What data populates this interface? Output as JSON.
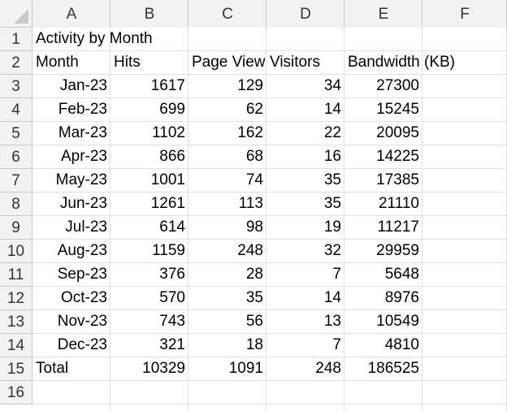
{
  "column_headers": [
    "A",
    "B",
    "C",
    "D",
    "E",
    "F"
  ],
  "row_headers": [
    "1",
    "2",
    "3",
    "4",
    "5",
    "6",
    "7",
    "8",
    "9",
    "10",
    "11",
    "12",
    "13",
    "14",
    "15",
    "16"
  ],
  "title": "Activity by Month",
  "headers": [
    "Month",
    "Hits",
    "Page View",
    "Visitors",
    "Bandwidth (KB)"
  ],
  "rows": [
    [
      "Jan-23",
      "1617",
      "129",
      "34",
      "27300"
    ],
    [
      "Feb-23",
      "699",
      "62",
      "14",
      "15245"
    ],
    [
      "Mar-23",
      "1102",
      "162",
      "22",
      "20095"
    ],
    [
      "Apr-23",
      "866",
      "68",
      "16",
      "14225"
    ],
    [
      "May-23",
      "1001",
      "74",
      "35",
      "17385"
    ],
    [
      "Jun-23",
      "1261",
      "113",
      "35",
      "21110"
    ],
    [
      "Jul-23",
      "614",
      "98",
      "19",
      "11217"
    ],
    [
      "Aug-23",
      "1159",
      "248",
      "32",
      "29959"
    ],
    [
      "Sep-23",
      "376",
      "28",
      "7",
      "5648"
    ],
    [
      "Oct-23",
      "570",
      "35",
      "14",
      "8976"
    ],
    [
      "Nov-23",
      "743",
      "56",
      "13",
      "10549"
    ],
    [
      "Dec-23",
      "321",
      "18",
      "7",
      "4810"
    ]
  ],
  "total": [
    "Total",
    "10329",
    "1091",
    "248",
    "186525"
  ]
}
